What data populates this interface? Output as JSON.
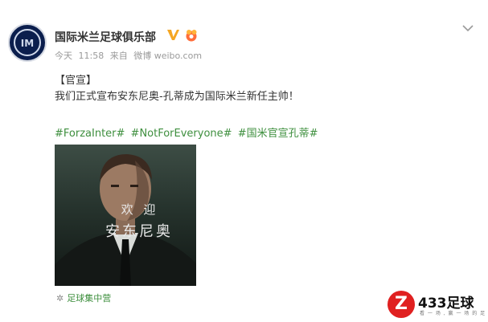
{
  "header": {
    "username": "国际米兰足球俱乐部",
    "verify_icon": "verified-v-icon",
    "vip_icon": "vip-badge-icon",
    "menu_icon": "chevron-down-icon"
  },
  "meta": {
    "day": "今天",
    "time": "11:58",
    "from_label": "来自",
    "client": "微博 weibo.com"
  },
  "post": {
    "line1": "【官宣】",
    "line2": "我们正式宣布安东尼奥-孔蒂成为国际米兰新任主帅！",
    "tags": [
      "#ForzaInter#",
      "#NotForEveryone#",
      "#国米官宣孔蒂#"
    ]
  },
  "image": {
    "caption_line1": "欢 迎",
    "caption_line2": "安东尼奥"
  },
  "source": {
    "icon": "flower-icon",
    "label": "足球集中营"
  },
  "watermark": {
    "logo": "Z",
    "title": "433足球",
    "subtitle": "看 一 场 , 赢 一 场 的 足 球 资 讯"
  },
  "colors": {
    "link_green": "#3e8f3e",
    "verify_gold": "#f5a623",
    "watermark_red": "#e02020"
  }
}
